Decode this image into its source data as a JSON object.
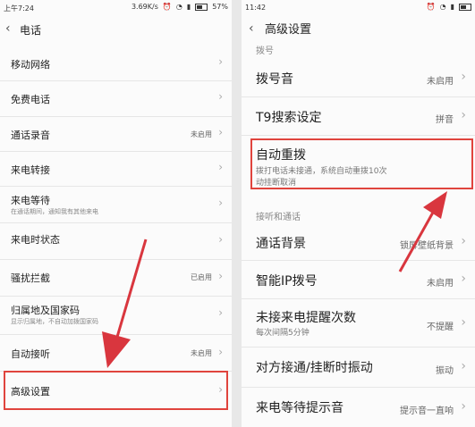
{
  "left": {
    "status": {
      "time": "上午7:24",
      "speed": "3.69K/s",
      "battery": "57%"
    },
    "title": "电话",
    "items": [
      {
        "label": "移动网络",
        "sub": "",
        "value": ""
      },
      {
        "label": "免费电话",
        "sub": "",
        "value": ""
      },
      {
        "label": "通话录音",
        "sub": "",
        "value": "未启用"
      },
      {
        "label": "来电转接",
        "sub": "",
        "value": ""
      },
      {
        "label": "来电等待",
        "sub": "在通话期间，通知我有其他来电",
        "value": ""
      },
      {
        "label": "来电时状态",
        "sub": "",
        "value": ""
      },
      {
        "label": "骚扰拦截",
        "sub": "",
        "value": "已启用"
      },
      {
        "label": "归属地及国家码",
        "sub": "显示归属地，不自动加拨国家码",
        "value": ""
      },
      {
        "label": "自动接听",
        "sub": "",
        "value": "未启用"
      },
      {
        "label": "高级设置",
        "sub": "",
        "value": ""
      }
    ]
  },
  "right": {
    "status": {
      "time": "11:42"
    },
    "title": "高级设置",
    "section1": "拨号",
    "section2": "接听和通话",
    "items": [
      {
        "label": "拨号音",
        "sub": "",
        "value": "未启用"
      },
      {
        "label": "T9搜索设定",
        "sub": "",
        "value": "拼音"
      },
      {
        "label": "自动重拨",
        "sub": "拨打电话未接通，系统自动重拨10次",
        "sub2": "动挂断取消",
        "value": ""
      },
      {
        "label": "通话背景",
        "sub": "",
        "value": "锁屏壁纸背景"
      },
      {
        "label": "智能IP拨号",
        "sub": "",
        "value": "未启用"
      },
      {
        "label": "未接来电提醒次数",
        "sub": "每次间隔5分钟",
        "value": "不提醒"
      },
      {
        "label": "对方接通/挂断时振动",
        "sub": "",
        "value": "振动"
      },
      {
        "label": "来电等待提示音",
        "sub": "",
        "value": "提示音一直响"
      }
    ]
  },
  "colors": {
    "highlight": "#e0443d",
    "arrow": "#d9363e"
  }
}
